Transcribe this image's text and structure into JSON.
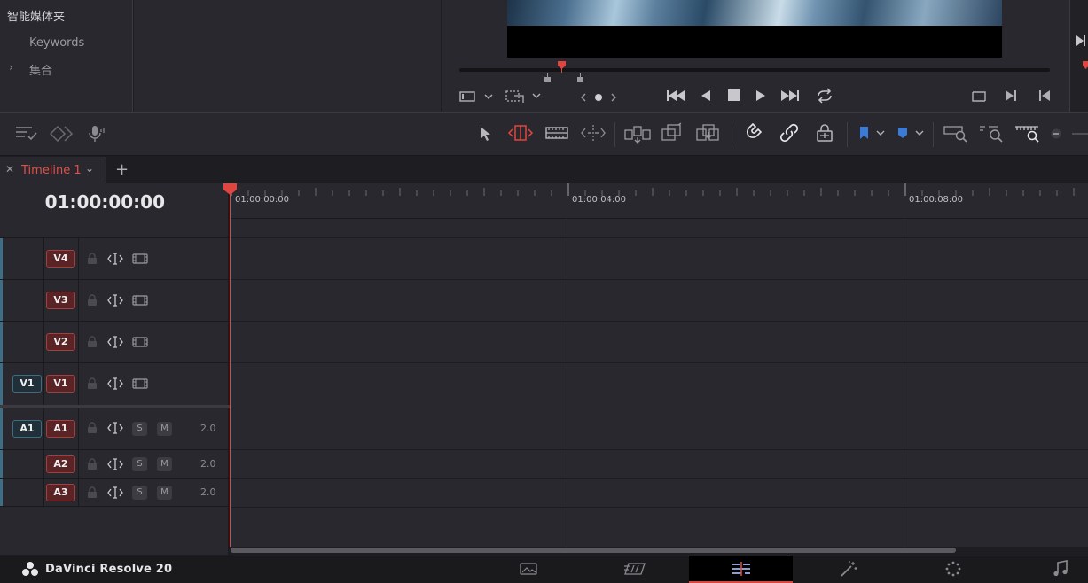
{
  "media_pool": {
    "header": "智能媒体夹",
    "items": [
      {
        "label": "Keywords"
      },
      {
        "label": "集合",
        "collapsed": true
      }
    ]
  },
  "timeline_tab": {
    "label": "Timeline 1",
    "add_tab_symbol": "+"
  },
  "timecode": "01:00:00:00",
  "ruler": {
    "labels": [
      "01:00:00:00",
      "01:00:04:00",
      "01:00:08:00"
    ]
  },
  "tracks": {
    "video": [
      {
        "label": "V4"
      },
      {
        "label": "V3"
      },
      {
        "label": "V2"
      },
      {
        "label": "V1",
        "source": "V1"
      }
    ],
    "audio": [
      {
        "label": "A1",
        "source": "A1",
        "solo": "S",
        "mute": "M",
        "channels": "2.0"
      },
      {
        "label": "A2",
        "solo": "S",
        "mute": "M",
        "channels": "2.0"
      },
      {
        "label": "A3",
        "solo": "S",
        "mute": "M",
        "channels": "2.0"
      }
    ]
  },
  "app": {
    "title": "DaVinci Resolve 20"
  },
  "pages": [
    {
      "icon": "media-page-icon",
      "active": false
    },
    {
      "icon": "cut-page-icon",
      "active": false
    },
    {
      "icon": "edit-page-icon",
      "active": true
    },
    {
      "icon": "fusion-page-icon",
      "active": false
    },
    {
      "icon": "color-page-icon",
      "active": false
    },
    {
      "icon": "fairlight-page-icon",
      "active": false
    }
  ],
  "colors": {
    "accent_red": "#e0463f",
    "track_dest": "#a0413f",
    "track_source": "#3b6e84",
    "flag_blue": "#3a7bd5"
  }
}
